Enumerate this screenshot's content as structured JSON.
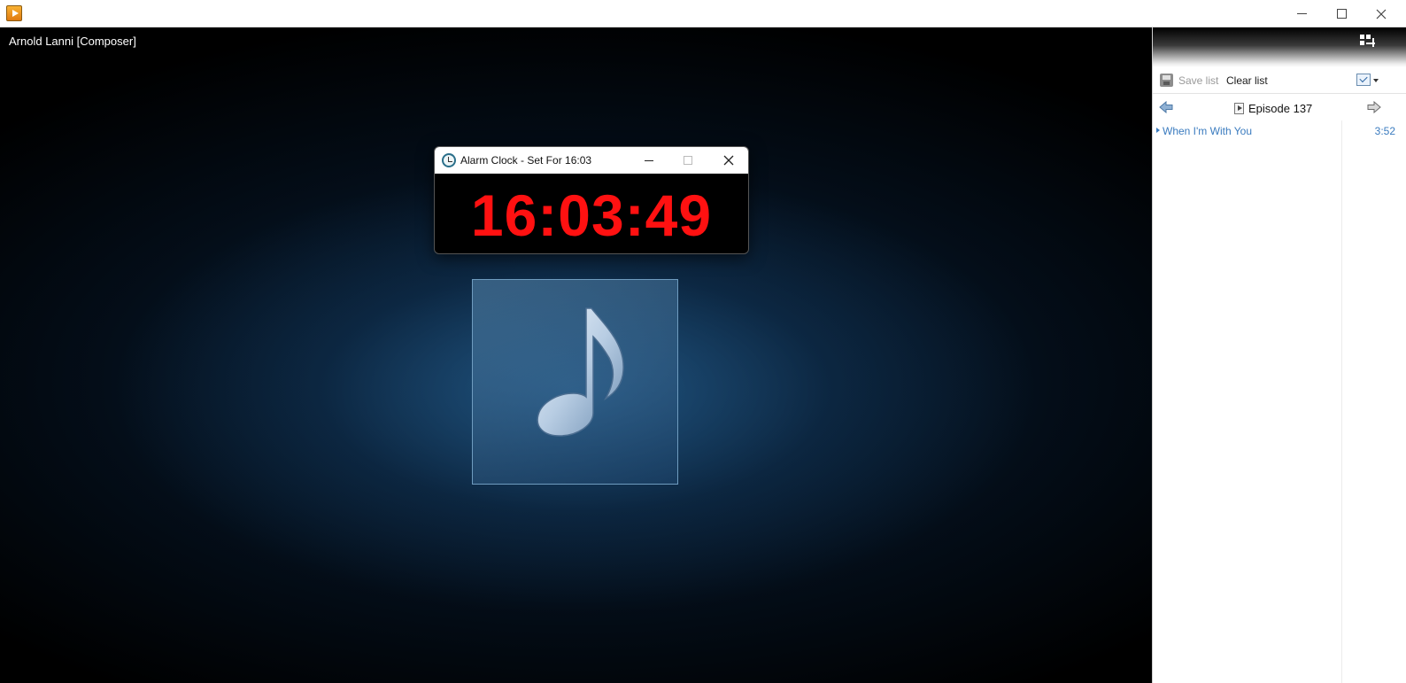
{
  "window": {
    "controls": {
      "minimize": "minimize",
      "maximize": "maximize",
      "close": "close"
    }
  },
  "visualization": {
    "title": "Arnold Lanni [Composer]",
    "album_art_icon": "music-note-icon"
  },
  "alarm_clock": {
    "title": "Alarm Clock - Set For 16:03",
    "time": "16:03:49",
    "time_color": "#ff1111"
  },
  "playlist": {
    "toolbar": {
      "save_label": "Save list",
      "clear_label": "Clear list"
    },
    "name": "Episode 137",
    "items": [
      {
        "title": "When I'm With You",
        "duration": "3:52"
      }
    ],
    "accent_color": "#3a7bbf"
  }
}
